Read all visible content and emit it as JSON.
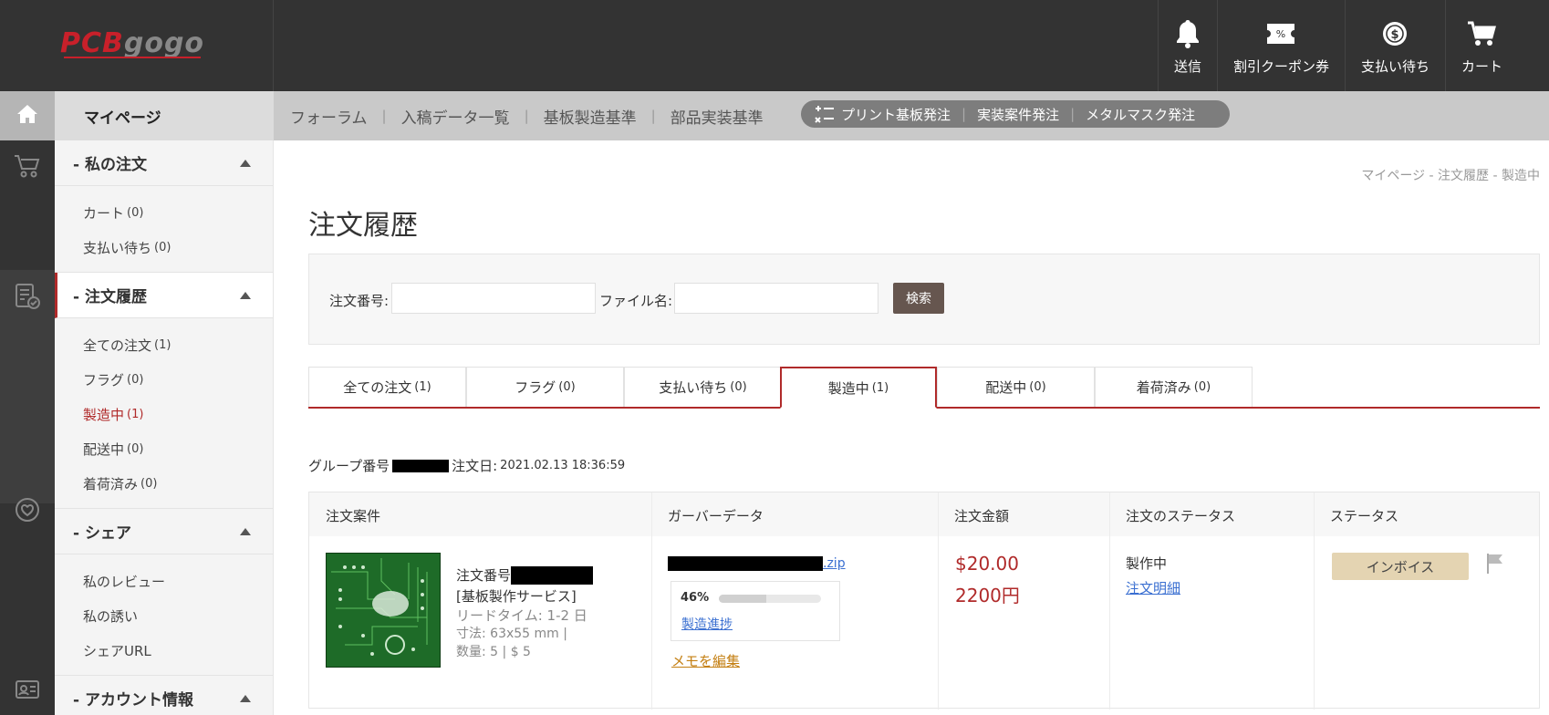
{
  "header": {
    "logo": {
      "part1": "PCB",
      "part2": "gogo"
    },
    "actions": [
      {
        "label": "送信",
        "icon": "bell-icon"
      },
      {
        "label": "割引クーポン券",
        "icon": "coupon-icon"
      },
      {
        "label": "支払い待ち",
        "icon": "dollar-coin-icon"
      },
      {
        "label": "カート",
        "icon": "cart-icon"
      }
    ]
  },
  "nav": {
    "mypage": "マイページ",
    "links": [
      "フォーラム",
      "入稿データ一覧",
      "基板製造基準",
      "部品実装基準"
    ],
    "pill": [
      "プリント基板発注",
      "実装案件発注",
      "メタルマスク発注"
    ]
  },
  "sidebar": {
    "sections": [
      {
        "title": "- 私の注文",
        "items": [
          {
            "label": "カート",
            "count": "(0)"
          },
          {
            "label": "支払い待ち",
            "count": "(0)"
          }
        ]
      },
      {
        "title": "- 注文履歴",
        "items": [
          {
            "label": "全ての注文",
            "count": "(1)"
          },
          {
            "label": "フラグ",
            "count": "(0)"
          },
          {
            "label": "製造中",
            "count": "(1)"
          },
          {
            "label": "配送中",
            "count": "(0)"
          },
          {
            "label": "着荷済み",
            "count": "(0)"
          }
        ]
      },
      {
        "title": "- シェア",
        "items": [
          {
            "label": "私のレビュー"
          },
          {
            "label": "私の誘い"
          },
          {
            "label": "シェアURL"
          }
        ]
      },
      {
        "title": "- アカウント情報"
      }
    ]
  },
  "breadcrumb": "マイページ - 注文履歴 - 製造中",
  "page_title": "注文履歴",
  "search": {
    "order_label": "注文番号:",
    "order_value": "",
    "file_label": "ファイル名:",
    "file_value": "",
    "button": "検索"
  },
  "tabs": [
    {
      "label": "全ての注文",
      "count": "(1)"
    },
    {
      "label": "フラグ",
      "count": "(0)"
    },
    {
      "label": "支払い待ち",
      "count": "(0)"
    },
    {
      "label": "製造中",
      "count": "(1)"
    },
    {
      "label": "配送中",
      "count": "(0)"
    },
    {
      "label": "着荷済み",
      "count": "(0)"
    }
  ],
  "group": {
    "label": "グループ番号",
    "date_label": "注文日:",
    "date": "2021.02.13 18:36:59"
  },
  "table": {
    "headers": [
      "注文案件",
      "ガーバーデータ",
      "注文金額",
      "注文のステータス",
      "ステータス"
    ],
    "row": {
      "order_no_label": "注文番号",
      "service": "[基板製作サービス]",
      "lead_time": "リードタイム: 1-2 日",
      "size": "寸法: 63x55 mm |",
      "quantity": "数量: 5 | $ 5",
      "file_ext": ".zip",
      "progress_text": "46%",
      "progress": 0.46,
      "progress_link": "製造進捗",
      "memo_link": "メモを編集",
      "price_usd": "$20.00",
      "price_jpy": "2200円",
      "order_status": "製作中",
      "detail_link": "注文明細",
      "invoice_button": "インボイス"
    }
  }
}
